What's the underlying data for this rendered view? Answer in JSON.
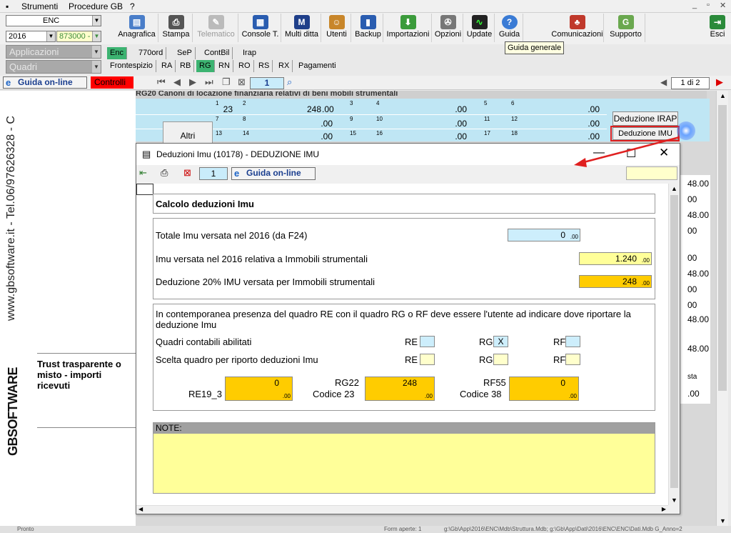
{
  "menubar": {
    "items": [
      "Strumenti",
      "Procedure GB",
      "?"
    ],
    "window_controls": [
      "_",
      "▫",
      "✕"
    ]
  },
  "left_controls": {
    "company": "ENC",
    "year": "2016",
    "code": "873000 -",
    "applicazioni": "Applicazioni",
    "quadri": "Quadri"
  },
  "toolbar": {
    "buttons": [
      "Anagrafica",
      "Stampa",
      "Telematico",
      "Console T.",
      "Multi ditta",
      "Utenti",
      "Backup",
      "Importazioni",
      "Opzioni",
      "Update",
      "Guida",
      "Comunicazioni",
      "Supporto",
      "Esci"
    ]
  },
  "tooltip": "Guida generale",
  "tabs_row1": [
    "Enc",
    "770ord",
    "SeP",
    "ContBil",
    "Irap"
  ],
  "tabs_row2": [
    "Frontespizio",
    "RA",
    "RB",
    "RG",
    "RN",
    "RO",
    "RS",
    "RX",
    "Pagamenti"
  ],
  "navbar": {
    "guida_label": "Guida on-line",
    "controlli_label": "Controlli",
    "page_input": "1",
    "page_count": "1 di 2"
  },
  "left_panel": {
    "vertical_text": "www.gbsoftware.it - Tel.06/97626328 - C",
    "brand": "GBSOFTWARE",
    "note": "Trust trasparente o misto - importi ricevuti"
  },
  "form_bg": {
    "header": "RG20 Canoni di locazione finanziaria relativi di beni mobili strumentali",
    "altri_label": "Altri",
    "deduzione_irap": "Deduzione IRAP",
    "deduzione_imu": "Deduzione IMU",
    "row1": {
      "n1": "1",
      "v1": "23",
      "n2": "2",
      "v2": "248",
      "n3": "3",
      "n4": "4",
      "n5": "5",
      "n6": "6"
    },
    "row2": {
      "n7": "7",
      "n8": "8",
      "n9": "9",
      "n10": "10",
      "n11": "11",
      "n12": "12"
    },
    "row3": {
      "n13": "13",
      "n14": "14",
      "n15": "15",
      "n16": "16",
      "n17": "17",
      "n18": "18"
    },
    "dec": ".00"
  },
  "modal": {
    "title": "Deduzioni Imu (10178) - DEDUZIONE IMU",
    "page_input": "1",
    "guida_label": "Guida on-line",
    "section_title": "Calcolo deduzioni Imu",
    "totale_label": "Totale Imu versata nel 2016 (da F24)",
    "totale_value": "0",
    "imu_strumentali_label": "Imu versata nel 2016 relativa a Immobili strumentali",
    "imu_strumentali_value": "1.240",
    "deduzione_label": "Deduzione 20% IMU versata per Immobili strumentali",
    "deduzione_value": "248",
    "dec": ".00",
    "info_text": "In contemporanea presenza del quadro RE con il quadro RG o RF deve essere l'utente ad indicare dove riportare la deduzione Imu",
    "abilitati_label": "Quadri contabili abilitati",
    "scelta_label": "Scelta quadro per riporto deduzioni Imu",
    "re_label": "RE",
    "rg_label": "RG",
    "rf_label": "RF",
    "rg_abilitato": "X",
    "re19_label": "RE19_3",
    "re19_value": "0",
    "rg22_label": "RG22",
    "rg22_code": "Codice 23",
    "rg22_value": "248",
    "rf55_label": "RF55",
    "rf55_code": "Codice 38",
    "rf55_value": "0",
    "note_label": "NOTE:"
  },
  "statusbar": {
    "left": "Pronto",
    "mid": "Form aperte: 1",
    "path": "g:\\Gb\\App\\2016\\ENC\\Mdb\\Struttura.Mdb; g:\\Gb\\App\\Dati\\2016\\ENC\\ENC\\Dati.Mdb G_Anno=2"
  },
  "right_values": [
    "48.00",
    "00",
    "48.00",
    "00",
    "00",
    "48.00",
    "00",
    "00",
    "48.00",
    "48.00",
    "sta",
    ".00"
  ],
  "colors": {
    "yellow_field": "#ffff99",
    "orange_field": "#ffcc00",
    "cyan_field": "#cdeefc",
    "accent_green": "#3cb371",
    "alert_red": "#ff0000"
  }
}
